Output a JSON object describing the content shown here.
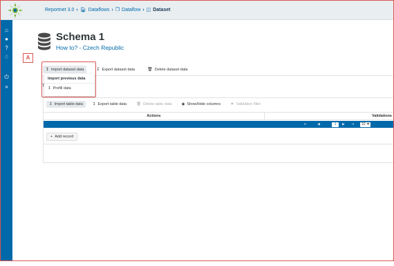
{
  "breadcrumb": {
    "items": [
      {
        "label": "Reportnet 3.0",
        "icon": "none"
      },
      {
        "label": "Dataflows",
        "icon": "home-icon"
      },
      {
        "label": "Dataflow",
        "icon": "clone-icon"
      },
      {
        "label": "Dataset",
        "icon": "database-icon"
      }
    ],
    "separator": "›"
  },
  "sidebar": {
    "icons": [
      "home-icon",
      "user-icon",
      "help-icon",
      "bell-icon",
      "power-icon",
      "expand-icon"
    ]
  },
  "header": {
    "title": "Schema 1",
    "subtitle": "How to? - Czech Republic"
  },
  "annotation": {
    "label": "A"
  },
  "toolbar": {
    "import_label": "Import dataset data",
    "export_label": "Export dataset data",
    "delete_label": "Delete dataset data"
  },
  "import_menu": {
    "items": [
      {
        "label": "Import previous data",
        "icon": ""
      },
      {
        "label": "Prefill data",
        "icon": "upload-icon"
      }
    ]
  },
  "tab_letter": "T",
  "table_toolbar": {
    "import_label": "Import table data",
    "export_label": "Export table data",
    "delete_label": "Delete table data",
    "columns_label": "Show/Hide columns",
    "filter_label": "Validation filter"
  },
  "table": {
    "columns": [
      "Actions",
      "Validations"
    ]
  },
  "paginator": {
    "current_page": "1",
    "rows_per_page": "10"
  },
  "add_record_label": "Add record",
  "footer_mark": "."
}
